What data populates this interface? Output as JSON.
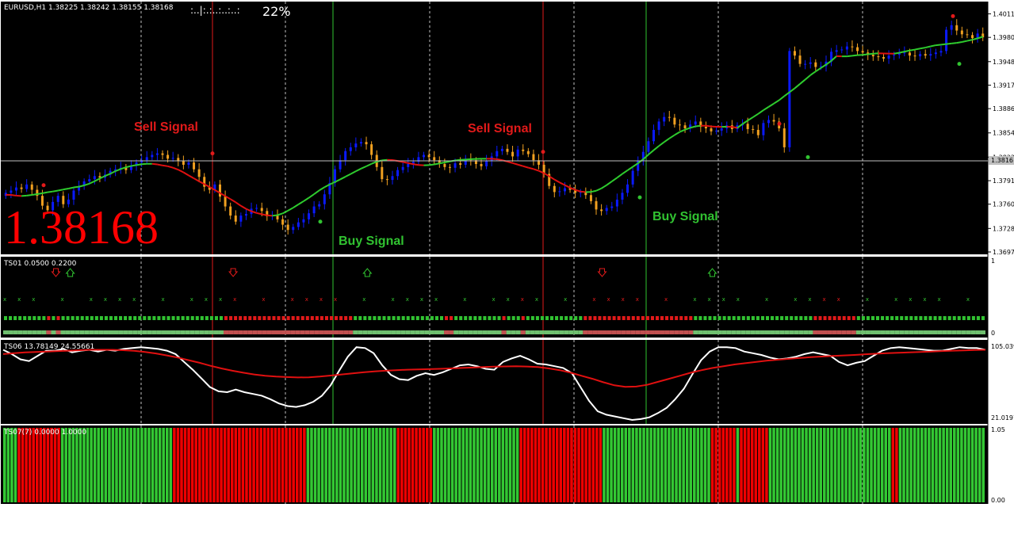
{
  "header": {
    "symbol_info": "EURUSD,H1  1.38225 1.38242 1.38155 1.38168",
    "progress_text": ":..|:.:..:..:..:",
    "progress_percent": "22%",
    "big_price": "1.38168",
    "price_tag": "1.3816"
  },
  "colors": {
    "background": "#000000",
    "bull_candle": "#0a1aff",
    "bear_candle": "#f0a020",
    "grid": "#c0c0c0",
    "buy": "#31c331",
    "sell": "#e21a1a",
    "ma_green": "#2ecc2e",
    "ma_red": "#e01010",
    "ts06_fast": "#ffffff",
    "ts06_slow": "#e01010"
  },
  "annotations": [
    {
      "text": "Sell Signal",
      "kind": "sell"
    },
    {
      "text": "Sell Signal",
      "kind": "sell"
    },
    {
      "text": "Buy Signal",
      "kind": "buy"
    },
    {
      "text": "Buy Signal",
      "kind": "buy"
    }
  ],
  "chart_data": [
    {
      "type": "candlestick",
      "title": "EURUSD,H1",
      "y_ticks": [
        "1.4011",
        "1.3980",
        "1.3948",
        "1.3917",
        "1.3886",
        "1.3854",
        "1.3822",
        "1.3791",
        "1.3760",
        "1.3728",
        "1.3697"
      ],
      "ylim": [
        1.3697,
        1.4023
      ],
      "close": [
        1.3775,
        1.3778,
        1.3782,
        1.378,
        1.3786,
        1.3779,
        1.3771,
        1.3758,
        1.3752,
        1.3763,
        1.3771,
        1.376,
        1.3766,
        1.3778,
        1.3784,
        1.379,
        1.3793,
        1.3797,
        1.3795,
        1.3799,
        1.3804,
        1.3806,
        1.3808,
        1.3805,
        1.3811,
        1.3815,
        1.3818,
        1.3822,
        1.3825,
        1.3827,
        1.3825,
        1.382,
        1.3821,
        1.3817,
        1.3812,
        1.3815,
        1.3806,
        1.3796,
        1.3783,
        1.3779,
        1.3786,
        1.377,
        1.3757,
        1.3745,
        1.3737,
        1.3745,
        1.3747,
        1.3754,
        1.3755,
        1.3751,
        1.3744,
        1.3745,
        1.374,
        1.3733,
        1.3726,
        1.373,
        1.3736,
        1.374,
        1.3748,
        1.3757,
        1.376,
        1.3773,
        1.3788,
        1.3806,
        1.3818,
        1.383,
        1.3835,
        1.384,
        1.3842,
        1.3839,
        1.3825,
        1.3809,
        1.3793,
        1.3792,
        1.3797,
        1.3805,
        1.3809,
        1.3813,
        1.3816,
        1.3822,
        1.3825,
        1.3822,
        1.3818,
        1.3813,
        1.3809,
        1.3808,
        1.3814,
        1.3812,
        1.382,
        1.3818,
        1.3813,
        1.381,
        1.3817,
        1.3823,
        1.383,
        1.3833,
        1.3829,
        1.3823,
        1.3832,
        1.383,
        1.3826,
        1.3818,
        1.3812,
        1.38,
        1.3784,
        1.3776,
        1.3777,
        1.3781,
        1.3779,
        1.3775,
        1.3776,
        1.3772,
        1.3764,
        1.3753,
        1.3751,
        1.3755,
        1.3757,
        1.3766,
        1.3775,
        1.3786,
        1.3804,
        1.3817,
        1.3829,
        1.3843,
        1.3858,
        1.3869,
        1.3875,
        1.3874,
        1.3865,
        1.3864,
        1.386,
        1.3865,
        1.3869,
        1.3862,
        1.386,
        1.3856,
        1.3857,
        1.386,
        1.3864,
        1.3859,
        1.3864,
        1.3866,
        1.3859,
        1.3858,
        1.3851,
        1.3867,
        1.3871,
        1.3869,
        1.386,
        1.3835,
        1.3962,
        1.3956,
        1.3945,
        1.3945,
        1.3947,
        1.3941,
        1.3942,
        1.3948,
        1.3961,
        1.3963,
        1.3964,
        1.3968,
        1.3967,
        1.3962,
        1.396,
        1.3957,
        1.3955,
        1.3954,
        1.3952,
        1.3956,
        1.3957,
        1.3959,
        1.396,
        1.3956,
        1.3955,
        1.3958,
        1.3956,
        1.3958,
        1.396,
        1.3962,
        1.399,
        1.3996,
        1.3989,
        1.3984,
        1.3983,
        1.3979,
        1.3985,
        1.398
      ],
      "annotations": [
        "Sell Signal",
        "Sell Signal",
        "Buy Signal",
        "Buy Signal"
      ]
    },
    {
      "type": "indicator",
      "title": "TS01 0.0500 0.2200",
      "y_ticks": [
        "1",
        "0"
      ],
      "arrows": [
        {
          "dir": "down",
          "bar": 11,
          "color": "sell"
        },
        {
          "dir": "up",
          "bar": 14,
          "color": "buy"
        },
        {
          "dir": "down",
          "bar": 48,
          "color": "sell"
        },
        {
          "dir": "up",
          "bar": 76,
          "color": "buy"
        },
        {
          "dir": "down",
          "bar": 125,
          "color": "sell"
        },
        {
          "dir": "up",
          "bar": 148,
          "color": "buy"
        }
      ],
      "state_row": [
        1,
        1,
        1,
        1,
        1,
        1,
        1,
        1,
        1,
        0,
        1,
        0,
        1,
        1,
        1,
        1,
        1,
        1,
        1,
        1,
        1,
        1,
        1,
        1,
        1,
        1,
        1,
        1,
        1,
        1,
        1,
        1,
        1,
        1,
        1,
        1,
        1,
        1,
        1,
        1,
        1,
        1,
        1,
        1,
        1,
        1,
        0,
        0,
        0,
        0,
        0,
        0,
        0,
        0,
        0,
        0,
        0,
        0,
        0,
        0,
        0,
        0,
        0,
        0,
        0,
        0,
        0,
        0,
        0,
        0,
        0,
        0,
        0,
        1,
        1,
        1,
        1,
        1,
        1,
        1,
        1,
        1,
        1,
        1,
        1,
        1,
        1,
        1,
        1,
        1,
        1,
        1,
        0,
        0,
        1,
        1,
        1,
        1,
        1,
        1,
        1,
        1,
        1,
        1,
        0,
        1,
        1,
        1,
        0,
        1,
        1,
        1,
        1,
        1,
        1,
        1,
        1,
        1,
        1,
        1,
        1,
        0,
        0,
        0,
        0,
        0,
        0,
        0,
        0,
        0,
        0,
        0,
        0,
        0,
        0,
        0,
        0,
        0,
        0,
        0,
        0,
        0,
        0,
        0,
        1,
        1,
        1,
        1,
        1,
        1,
        1,
        1,
        1,
        1,
        1,
        1,
        1,
        1,
        1,
        1,
        1,
        1,
        1,
        1,
        1,
        1,
        1,
        1,
        1,
        0,
        0,
        0,
        0,
        0,
        0,
        0,
        0,
        0,
        1,
        1,
        1,
        1,
        1,
        1,
        1,
        1,
        1,
        1,
        1,
        1,
        1,
        1,
        1,
        1,
        1,
        1,
        1,
        1,
        1,
        1,
        1,
        1,
        1,
        1,
        1
      ]
    },
    {
      "type": "line",
      "title": "TS06 13.78149 24.55661",
      "y_ticks": [
        "105.0397",
        "21.0197"
      ],
      "series": [
        {
          "values": [
            101,
            96,
            90,
            88,
            94,
            100,
            100,
            102,
            98,
            100,
            101,
            99,
            101,
            100,
            102,
            103,
            104,
            103,
            102,
            100,
            96,
            87,
            78,
            68,
            58,
            53,
            52,
            55,
            52,
            50,
            48,
            44,
            39,
            36,
            35,
            37,
            41,
            48,
            60,
            77,
            93,
            104,
            103,
            97,
            83,
            72,
            67,
            66,
            71,
            74,
            72,
            75,
            79,
            83,
            84,
            82,
            79,
            78,
            87,
            91,
            94,
            90,
            85,
            84,
            82,
            80,
            74,
            58,
            42,
            30,
            26,
            24,
            22,
            20,
            21,
            23,
            28,
            34,
            44,
            56,
            73,
            89,
            99,
            104,
            104,
            103,
            99,
            97,
            95,
            92,
            90,
            91,
            93,
            96,
            98,
            96,
            94,
            87,
            83,
            86,
            88,
            94,
            100,
            103,
            104,
            103,
            102,
            101,
            100,
            100,
            102,
            104,
            103,
            103,
            101
          ]
        },
        {
          "values": [
            96,
            97,
            98,
            98.5,
            99,
            99.5,
            100,
            100.5,
            101,
            101,
            101,
            100.5,
            99.8,
            98.5,
            96.8,
            94.5,
            92,
            89,
            86,
            82.5,
            79.5,
            76.8,
            74.5,
            72.5,
            71,
            70,
            69.5,
            69,
            69.2,
            70,
            71.2,
            72.5,
            73.8,
            75,
            76,
            76.8,
            77.5,
            78,
            78.3,
            78.6,
            79,
            79.5,
            80,
            80.5,
            81,
            81.5,
            81.8,
            82,
            81.7,
            81,
            79.5,
            77.5,
            74.5,
            71,
            67.5,
            63.5,
            60,
            58.2,
            58.5,
            60.5,
            64,
            67.5,
            71,
            74.5,
            77.5,
            80,
            82,
            84,
            85.5,
            87,
            88.5,
            89.5,
            90.5,
            91.5,
            92.5,
            93.2,
            93.8,
            94.5,
            95,
            95.8,
            96.5,
            97,
            97.5,
            98,
            98.5,
            99,
            99.5,
            100,
            100.3,
            100.7,
            101
          ]
        }
      ]
    },
    {
      "type": "histogram",
      "title": "TS07(7) 0.0000 1.0000",
      "y_ticks": [
        "1.05",
        "0.00"
      ],
      "segments": [
        {
          "color": "buy",
          "bars": 4
        },
        {
          "color": "sell",
          "bars": 12
        },
        {
          "color": "buy",
          "bars": 31
        },
        {
          "color": "sell",
          "bars": 37
        },
        {
          "color": "buy",
          "bars": 25
        },
        {
          "color": "sell",
          "bars": 10
        },
        {
          "color": "buy",
          "bars": 24
        },
        {
          "color": "sell",
          "bars": 23
        },
        {
          "color": "buy",
          "bars": 30
        },
        {
          "color": "sell",
          "bars": 7
        },
        {
          "color": "buy",
          "bars": 1
        },
        {
          "color": "sell",
          "bars": 8
        },
        {
          "color": "buy",
          "bars": 34
        },
        {
          "color": "sell",
          "bars": 2
        },
        {
          "color": "buy",
          "bars": 24
        }
      ]
    }
  ]
}
